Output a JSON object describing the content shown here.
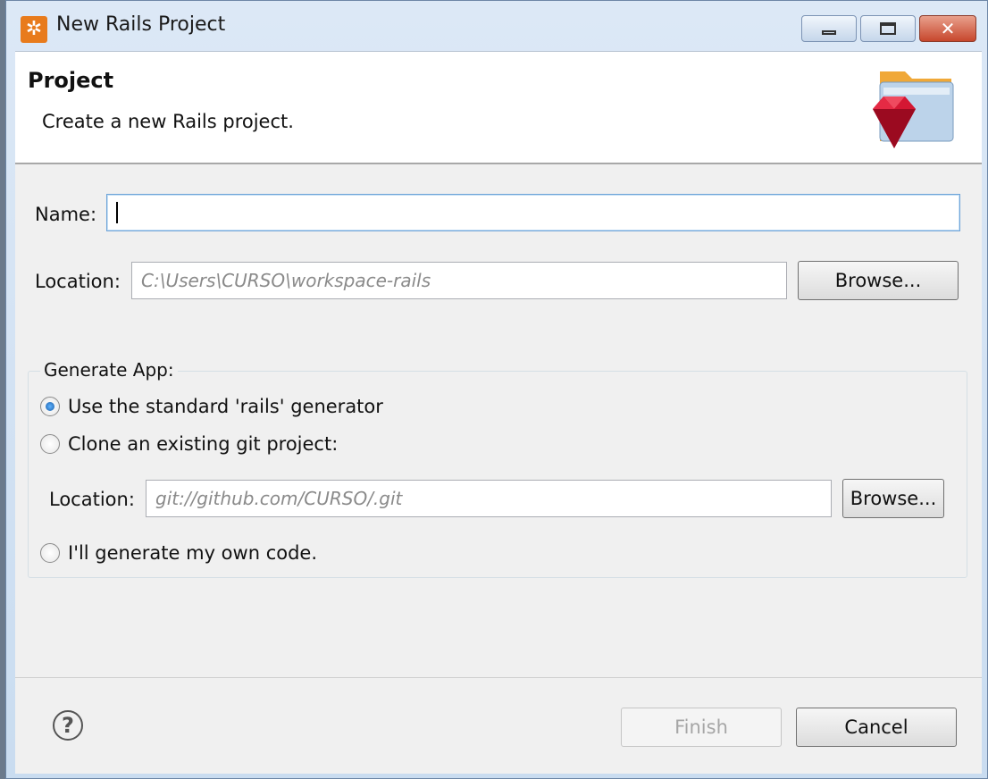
{
  "window": {
    "title": "New Rails Project",
    "app_icon": "gear-icon",
    "controls": {
      "minimize": "minimize-icon",
      "maximize": "maximize-icon",
      "close": "close-icon"
    }
  },
  "header": {
    "title": "Project",
    "description": "Create a new Rails project.",
    "banner_icon": "ruby-folder-icon"
  },
  "form": {
    "name_label": "Name:",
    "name_value": "",
    "location_label": "Location:",
    "location_placeholder": "C:\\Users\\CURSO\\workspace-rails",
    "browse_label": "Browse..."
  },
  "generate_app": {
    "legend": "Generate App:",
    "options": [
      {
        "label": "Use the standard 'rails' generator",
        "checked": true
      },
      {
        "label": "Clone an existing git project:",
        "checked": false
      },
      {
        "label": "I'll generate my own code.",
        "checked": false
      }
    ],
    "git_location_label": "Location:",
    "git_location_placeholder": "git://github.com/CURSO/.git",
    "git_browse_label": "Browse..."
  },
  "footer": {
    "help_icon": "help-icon",
    "finish_label": "Finish",
    "cancel_label": "Cancel"
  }
}
